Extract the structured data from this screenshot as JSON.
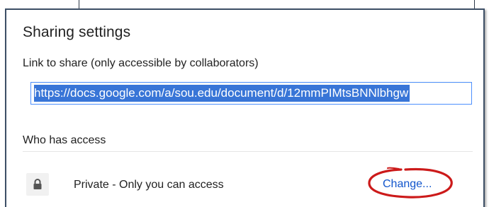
{
  "dialog": {
    "title": "Sharing settings",
    "link_label": "Link to share (only accessible by collaborators)",
    "link_value": "https://docs.google.com/a/sou.edu/document/d/12mmPIMtsBNNlbhgw",
    "access_label": "Who has access",
    "access_entry": {
      "icon": "lock-icon",
      "text": "Private - Only you can access",
      "change_label": "Change..."
    }
  },
  "colors": {
    "selection": "#3875d7",
    "link": "#1155cc",
    "annotation_circle": "#cc1a1a",
    "input_focus_border": "#4d90fe"
  }
}
